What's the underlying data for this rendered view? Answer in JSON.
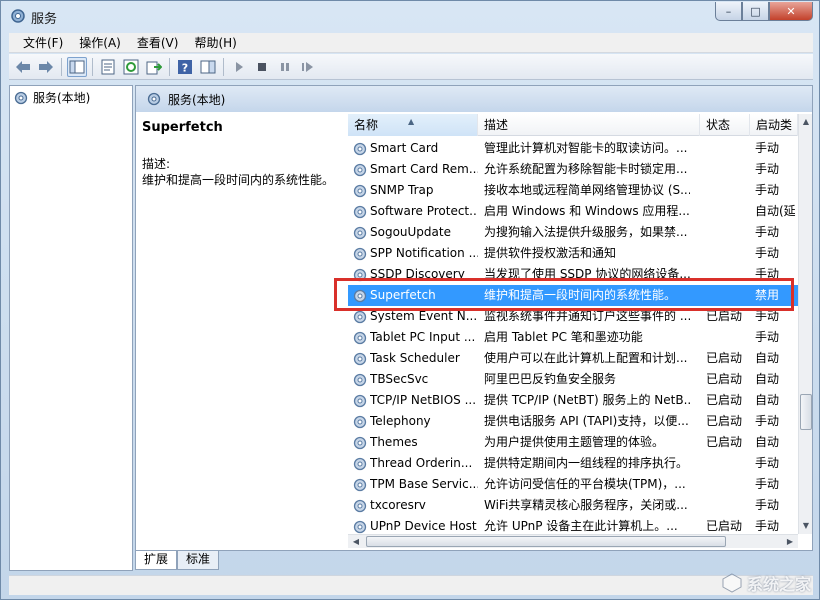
{
  "window": {
    "title": "服务",
    "buttons": {
      "minimize": "–",
      "maximize": "□",
      "close": "✕"
    }
  },
  "menu": [
    "文件(F)",
    "操作(A)",
    "查看(V)",
    "帮助(H)"
  ],
  "toolbar_icons": [
    "back-arrow-icon",
    "forward-arrow-icon",
    "console-tree-icon",
    "properties-icon",
    "refresh-icon",
    "export-icon",
    "help-icon",
    "show-pane-icon",
    "start-icon",
    "stop-icon",
    "pause-icon",
    "restart-icon"
  ],
  "tree": {
    "root_label": "服务(本地)"
  },
  "content": {
    "header_label": "服务(本地)",
    "selected_name": "Superfetch",
    "desc_label": "描述:",
    "desc_text": "维护和提高一段时间内的系统性能。"
  },
  "columns": {
    "name": "名称",
    "desc": "描述",
    "status": "状态",
    "start": "启动类"
  },
  "services": [
    {
      "name": "Smart Card",
      "desc": "管理此计算机对智能卡的取读访问。...",
      "status": "",
      "start": "手动"
    },
    {
      "name": "Smart Card Rem...",
      "desc": "允许系统配置为移除智能卡时锁定用...",
      "status": "",
      "start": "手动"
    },
    {
      "name": "SNMP Trap",
      "desc": "接收本地或远程简单网络管理协议 (S...",
      "status": "",
      "start": "手动"
    },
    {
      "name": "Software Protect...",
      "desc": "启用 Windows 和 Windows 应用程...",
      "status": "",
      "start": "自动(延"
    },
    {
      "name": "SogouUpdate",
      "desc": "为搜狗输入法提供升级服务，如果禁...",
      "status": "",
      "start": "手动"
    },
    {
      "name": "SPP Notification ...",
      "desc": "提供软件授权激活和通知",
      "status": "",
      "start": "手动"
    },
    {
      "name": "SSDP Discovery",
      "desc": "当发现了使用 SSDP 协议的网络设备...",
      "status": "",
      "start": "手动"
    },
    {
      "name": "Superfetch",
      "desc": "维护和提高一段时间内的系统性能。",
      "status": "",
      "start": "禁用"
    },
    {
      "name": "System Event N...",
      "desc": "监视系统事件并通知订户这些事件的 ...",
      "status": "已启动",
      "start": "手动"
    },
    {
      "name": "Tablet PC Input ...",
      "desc": "启用 Tablet PC 笔和墨迹功能",
      "status": "",
      "start": "手动"
    },
    {
      "name": "Task Scheduler",
      "desc": "使用户可以在此计算机上配置和计划...",
      "status": "已启动",
      "start": "自动"
    },
    {
      "name": "TBSecSvc",
      "desc": "阿里巴巴反钓鱼安全服务",
      "status": "已启动",
      "start": "自动"
    },
    {
      "name": "TCP/IP NetBIOS ...",
      "desc": "提供 TCP/IP (NetBT) 服务上的 NetB...",
      "status": "已启动",
      "start": "自动"
    },
    {
      "name": "Telephony",
      "desc": "提供电话服务 API (TAPI)支持，以便...",
      "status": "已启动",
      "start": "手动"
    },
    {
      "name": "Themes",
      "desc": "为用户提供使用主题管理的体验。",
      "status": "已启动",
      "start": "自动"
    },
    {
      "name": "Thread Orderin...",
      "desc": "提供特定期间内一组线程的排序执行。",
      "status": "",
      "start": "手动"
    },
    {
      "name": "TPM Base Servic...",
      "desc": "允许访问受信任的平台模块(TPM)，...",
      "status": "",
      "start": "手动"
    },
    {
      "name": "txcoresrv",
      "desc": "WiFi共享精灵核心服务程序，关闭或...",
      "status": "",
      "start": "手动"
    },
    {
      "name": "UPnP Device Host",
      "desc": "允许 UPnP 设备主在此计算机上。...",
      "status": "已启动",
      "start": "手动"
    }
  ],
  "selected_index": 7,
  "tabs": [
    "扩展",
    "标准"
  ],
  "watermark": "系统之家",
  "colors": {
    "selection": "#3399ff",
    "highlight_box": "#d9302a"
  }
}
